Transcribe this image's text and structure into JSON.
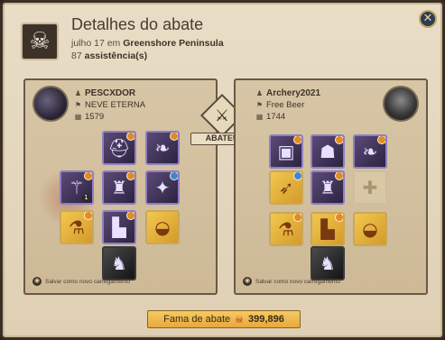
{
  "header": {
    "title": "Detalhes do abate",
    "date": "julho 17 em",
    "location": "Greenshore Peninsula",
    "assist_count": "87",
    "assist_label": "assistência(s)",
    "close_label": "✕"
  },
  "killer": {
    "name": "PESCXDOR",
    "guild": "NEVE ETERNA",
    "item_power": "1579",
    "save_label": "Salvar como novo carregamento"
  },
  "victim": {
    "name": "Archery2021",
    "guild": "Free Beer",
    "item_power": "1744",
    "save_label": "Salvar como novo carregamento"
  },
  "center": {
    "abateu_label": "ABATEU"
  },
  "fame": {
    "label": "Fama de abate",
    "value": "399,896"
  },
  "colors": {
    "parchment": "#e9ddc7",
    "panel": "#d7c6a6",
    "epic_border": "#8f7fc4",
    "gold_slot": "#f0c850",
    "fame_bar": "#f6ca64"
  },
  "icons": {
    "header": "skull-crossbones-icon",
    "center": "crossed-swords-icon",
    "fame": "skull-fame-icon",
    "close": "close-icon"
  }
}
